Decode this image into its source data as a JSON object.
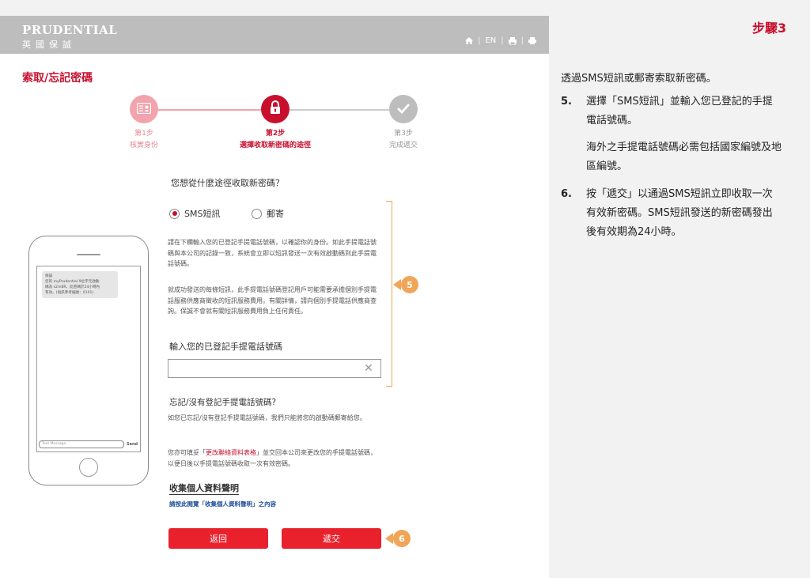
{
  "header": {
    "logo_en": "PRUDENTIAL",
    "logo_zh": "英國保誠",
    "lang_label": "EN",
    "icons": [
      "home-icon",
      "printer-icon",
      "print-icon"
    ]
  },
  "page": {
    "title": "索取/忘記密碼"
  },
  "stepper": {
    "steps": [
      {
        "label": "第1步",
        "desc": "核實身份",
        "icon": "id-card-icon",
        "state": "done"
      },
      {
        "label": "第2步",
        "desc": "選擇收取新密碼的途徑",
        "icon": "lock-icon",
        "state": "active"
      },
      {
        "label": "第3步",
        "desc": "完成遞交",
        "icon": "check-icon",
        "state": "pending"
      }
    ],
    "colors": {
      "done": "#f2a3ab",
      "active": "#c8102e",
      "pending": "#bdbdbd"
    }
  },
  "form": {
    "question": "您想從什麼途徑收取新密碼？",
    "options": [
      {
        "label": "SMS短訊",
        "selected": true
      },
      {
        "label": "郵寄",
        "selected": false
      }
    ],
    "paragraph1": "請在下欄輸入您的已登記手提電話號碼，以確認你的身份。如此手提電話號碼與本公司的記錄一致，系統會立即以短訊發送一次有效啟動碼到此手提電話號碼。",
    "paragraph2": "就成功發送的每條短訊，此手提電話號碼登記用戶可能需要承擔個別手提電話服務供應商徵收的短訊服務費用。有關詳情，請向個別手提電話供應商查詢。保誠不會就有關短訊服務費用負上任何責任。",
    "phone_label": "輸入您的已登記手提電話號碼",
    "phone_value": "",
    "forgot_title": "忘記/沒有登記手提電話號碼?",
    "forgot_text": "如您已忘記/沒有登記手提電話號碼，我們只能將您的啟動碼郵寄給您。",
    "update_pre": "您亦可填妥「",
    "update_link": "更改聯絡資料表格",
    "update_post": "」並交回本公司來更改您的手提電話號碼，以便日後以手提電話號碼收取一次有效密碼。",
    "privacy_title": "收集個人資料聲明",
    "privacy_link": "請按此閱覽「收集個人資料聲明」之內容",
    "back_label": "返回",
    "submit_label": "遞交"
  },
  "annotations": {
    "badge_a": "5",
    "badge_b": "6"
  },
  "phone_mock": {
    "sms_lines": [
      "保誠",
      "您的 myPrudential 9位字元啟動",
      "碼為 s2m8R，此密碼於24小時內",
      "有效。(短訊參考編號：0101)"
    ],
    "input_placeholder": "Text Message",
    "send_label": "Send"
  },
  "instructions": {
    "step_tag": "步驟3",
    "intro": "透過SMS短訊或郵寄索取新密碼。",
    "items": [
      {
        "num": "5.",
        "text": "選擇「SMS短訊」並輸入您已登記的手提電話號碼。"
      },
      {
        "num": "6.",
        "text": "按「遞交」以通過SMS短訊立即收取一次有效新密碼。SMS短訊發送的新密碼發出後有效期為24小時。"
      }
    ],
    "note": "海外之手提電話號碼必需包括國家編號及地區編號。"
  }
}
